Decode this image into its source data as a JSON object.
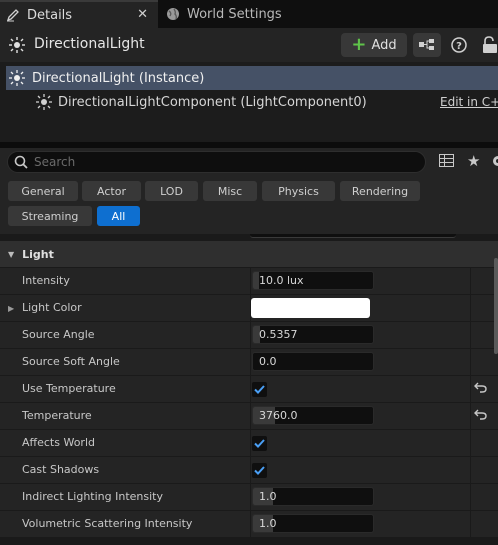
{
  "tabs": {
    "details": "Details",
    "world_settings": "World Settings"
  },
  "header": {
    "actor_name": "DirectionalLight",
    "add_label": "Add"
  },
  "tree": {
    "instance_label": "DirectionalLight (Instance)",
    "component_label": "DirectionalLightComponent (LightComponent0)",
    "edit_link": "Edit in C++"
  },
  "search": {
    "placeholder": "Search"
  },
  "filters": [
    "General",
    "Actor",
    "LOD",
    "Misc",
    "Physics",
    "Rendering",
    "Streaming",
    "All"
  ],
  "active_filter": "All",
  "category": {
    "name": "Light"
  },
  "properties": [
    {
      "label": "Intensity",
      "type": "number",
      "value": "10.0 lux"
    },
    {
      "label": "Light Color",
      "type": "color",
      "value": "#ffffff"
    },
    {
      "label": "Source Angle",
      "type": "number",
      "value": "0.5357"
    },
    {
      "label": "Source Soft Angle",
      "type": "number",
      "value": "0.0"
    },
    {
      "label": "Use Temperature",
      "type": "checkbox",
      "checked": true
    },
    {
      "label": "Temperature",
      "type": "number",
      "value": "3760.0"
    },
    {
      "label": "Affects World",
      "type": "checkbox",
      "checked": true
    },
    {
      "label": "Cast Shadows",
      "type": "checkbox",
      "checked": true
    },
    {
      "label": "Indirect Lighting Intensity",
      "type": "number",
      "value": "1.0"
    },
    {
      "label": "Volumetric Scattering Intensity",
      "type": "number",
      "value": "1.0"
    }
  ],
  "colors": {
    "accent_blue": "#0e6fd0",
    "selection": "#455166",
    "add_plus": "#5fc34a"
  }
}
